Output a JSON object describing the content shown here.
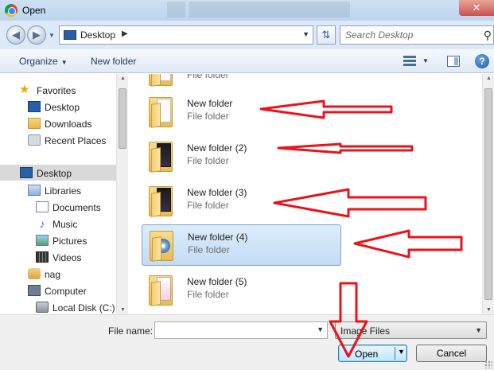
{
  "window": {
    "title": "Open"
  },
  "nav": {
    "back_label": "Back",
    "forward_label": "Forward",
    "address": "Desktop",
    "search_placeholder": "Search Desktop"
  },
  "toolbar": {
    "organize": "Organize",
    "new_folder": "New folder"
  },
  "sidebar": {
    "items": [
      {
        "label": "Favorites",
        "icon": "star-icon",
        "selected": false
      },
      {
        "label": "Desktop",
        "icon": "desktop-icon",
        "selected": false
      },
      {
        "label": "Downloads",
        "icon": "downloads-folder-icon",
        "selected": false
      },
      {
        "label": "Recent Places",
        "icon": "recent-places-icon",
        "selected": false
      },
      {
        "label": "Desktop",
        "icon": "desktop-icon",
        "selected": true
      },
      {
        "label": "Libraries",
        "icon": "libraries-icon",
        "selected": false
      },
      {
        "label": "Documents",
        "icon": "documents-icon",
        "selected": false
      },
      {
        "label": "Music",
        "icon": "music-icon",
        "selected": false
      },
      {
        "label": "Pictures",
        "icon": "pictures-icon",
        "selected": false
      },
      {
        "label": "Videos",
        "icon": "videos-icon",
        "selected": false
      },
      {
        "label": "nag",
        "icon": "user-folder-icon",
        "selected": false
      },
      {
        "label": "Computer",
        "icon": "computer-icon",
        "selected": false
      },
      {
        "label": "Local Disk (C:)",
        "icon": "local-disk-icon",
        "selected": false
      }
    ]
  },
  "files": [
    {
      "name": "New folder",
      "type": "File folder",
      "selected": false
    },
    {
      "name": "New folder (2)",
      "type": "File folder",
      "selected": false
    },
    {
      "name": "New folder (3)",
      "type": "File folder",
      "selected": false
    },
    {
      "name": "New folder (4)",
      "type": "File folder",
      "selected": true
    },
    {
      "name": "New folder (5)",
      "type": "File folder",
      "selected": false
    }
  ],
  "partial_file": {
    "type": "File folder"
  },
  "bottom": {
    "file_name_label": "File name:",
    "file_name_value": "",
    "file_type": "Image Files",
    "open_label": "Open",
    "cancel_label": "Cancel"
  },
  "colors": {
    "annotation_red": "#e8131b",
    "selection_fill": "#cde4fb",
    "selection_border": "#7da2ce",
    "title_bar": "#c3d8f0"
  }
}
